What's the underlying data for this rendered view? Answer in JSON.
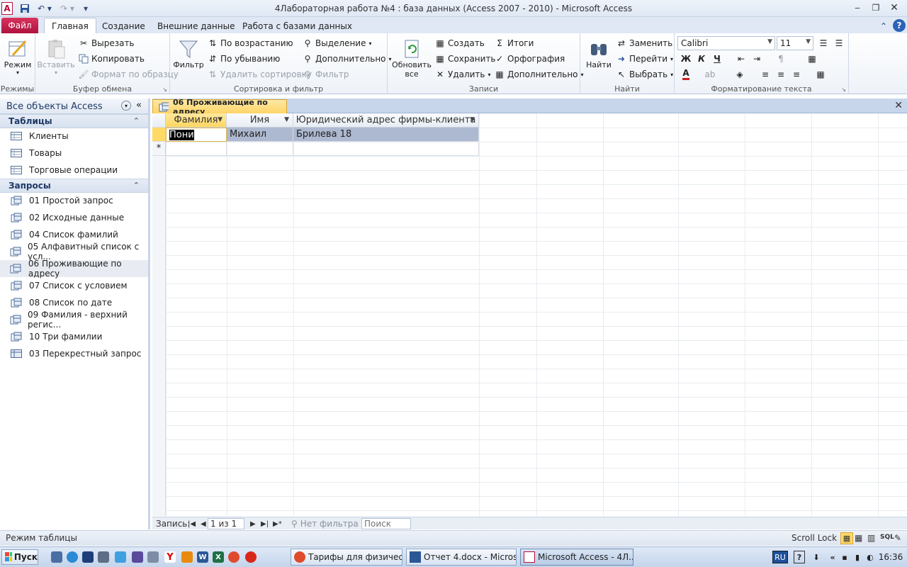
{
  "window": {
    "title": "4Лабораторная работа №4 : база данных (Access 2007 - 2010)  -  Microsoft Access",
    "app_icon_letter": "A"
  },
  "tabs": {
    "file": "Файл",
    "items": [
      "Главная",
      "Создание",
      "Внешние данные",
      "Работа с базами данных"
    ]
  },
  "ribbon": {
    "groups": {
      "views": "Режимы",
      "clipboard": "Буфер обмена",
      "sort_filter": "Сортировка и фильтр",
      "records": "Записи",
      "find": "Найти",
      "text_format": "Форматирование текста"
    },
    "view_label": "Режим",
    "paste_label": "Вставить",
    "cut": "Вырезать",
    "copy": "Копировать",
    "format_painter": "Формат по образцу",
    "filter": "Фильтр",
    "ascending": "По возрастанию",
    "descending": "По убыванию",
    "remove_sort": "Удалить сортировку",
    "selection": "Выделение",
    "advanced": "Дополнительно",
    "toggle_filter": "Фильтр",
    "refresh_all_1": "Обновить",
    "refresh_all_2": "все",
    "new_record": "Создать",
    "save_record": "Сохранить",
    "delete_record": "Удалить",
    "totals": "Итоги",
    "spelling": "Орфография",
    "more": "Дополнительно",
    "find": "Найти",
    "replace": "Заменить",
    "goto": "Перейти",
    "select": "Выбрать",
    "font_name": "Calibri",
    "font_size": "11",
    "bold": "Ж",
    "italic": "К",
    "underline": "Ч",
    "font_color_letter": "A"
  },
  "nav": {
    "title": "Все объекты Access",
    "tables_label": "Таблицы",
    "tables": [
      "Клиенты",
      "Товары",
      "Торговые операции"
    ],
    "queries_label": "Запросы",
    "queries": [
      "01 Простой запрос",
      "02 Исходные данные",
      "04 Список фамилий",
      "05 Алфавитный список с усл...",
      "06 Проживающие по адресу",
      "07 Список с условием",
      "08 Список по дате",
      "09 Фамилия - верхний регис...",
      "10 Три фамилии",
      "03 Перекрестный запрос"
    ],
    "selected_index": 4
  },
  "document": {
    "tab_title": "06 Проживающие по адресу",
    "columns": [
      "Фамилия",
      "Имя",
      "Юридический адрес фирмы-клиента"
    ],
    "rows": [
      [
        "Пони",
        "Михаил",
        "Брилева 18"
      ]
    ],
    "new_row_marker": "*"
  },
  "record_nav": {
    "label": "Запись:",
    "position": "1 из 1",
    "filter_state": "Нет фильтра",
    "search_placeholder": "Поиск"
  },
  "statusbar": {
    "mode": "Режим таблицы",
    "scroll_lock": "Scroll Lock",
    "sql": "SQL"
  },
  "taskbar": {
    "start": "Пуск",
    "tasks": [
      "Тарифы для физически...",
      "Отчет 4.docx - Microsof...",
      "Microsoft Access - 4Л..."
    ],
    "lang": "RU",
    "time": "16:36"
  }
}
